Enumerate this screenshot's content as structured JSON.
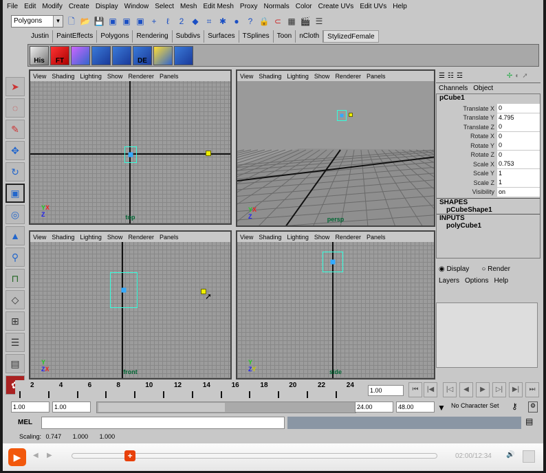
{
  "menu": [
    "File",
    "Edit",
    "Modify",
    "Create",
    "Display",
    "Window",
    "Select",
    "Mesh",
    "Edit Mesh",
    "Proxy",
    "Normals",
    "Color",
    "Create UVs",
    "Edit UVs",
    "Help"
  ],
  "mode_dropdown": "Polygons",
  "shelf_tabs": [
    "Justin",
    "PaintEffects",
    "Polygons",
    "Rendering",
    "Subdivs",
    "Surfaces",
    "TSplines",
    "Toon",
    "nCloth",
    "StylizedFemale"
  ],
  "shelf_buttons": [
    "His",
    "FT",
    "",
    "",
    "",
    "DE",
    "",
    ""
  ],
  "viewport_menu": [
    "View",
    "Shading",
    "Lighting",
    "Show",
    "Renderer",
    "Panels"
  ],
  "viewports": {
    "top": "top",
    "persp": "persp",
    "front": "front",
    "side": "side"
  },
  "channel_box": {
    "tabs": [
      "Channels",
      "Object"
    ],
    "object": "pCube1",
    "channels": [
      {
        "name": "Translate X",
        "value": "0"
      },
      {
        "name": "Translate Y",
        "value": "4.795"
      },
      {
        "name": "Translate Z",
        "value": "0"
      },
      {
        "name": "Rotate X",
        "value": "0"
      },
      {
        "name": "Rotate Y",
        "value": "0"
      },
      {
        "name": "Rotate Z",
        "value": "0"
      },
      {
        "name": "Scale X",
        "value": "0.753"
      },
      {
        "name": "Scale Y",
        "value": "1"
      },
      {
        "name": "Scale Z",
        "value": "1"
      },
      {
        "name": "Visibility",
        "value": "on"
      }
    ],
    "shapes_label": "SHAPES",
    "shape": "pCubeShape1",
    "inputs_label": "INPUTS",
    "input": "polyCube1"
  },
  "layers": {
    "display": "Display",
    "render": "Render",
    "menu": [
      "Layers",
      "Options",
      "Help"
    ]
  },
  "timeline": {
    "ticks": [
      "2",
      "4",
      "6",
      "8",
      "10",
      "12",
      "14",
      "16",
      "18",
      "20",
      "22",
      "24"
    ],
    "current_frame": "1",
    "current_time": "1.00"
  },
  "range": {
    "start": "1.00",
    "playback_start": "1.00",
    "playback_end": "24.00",
    "end": "48.00",
    "character_set": "No Character Set"
  },
  "mel": {
    "label": "MEL",
    "value": ""
  },
  "status": {
    "label": "Scaling:",
    "values": [
      "0.747",
      "1.000",
      "1.000"
    ]
  },
  "player": {
    "time": "02:00/12:34",
    "progress": 0.16
  }
}
